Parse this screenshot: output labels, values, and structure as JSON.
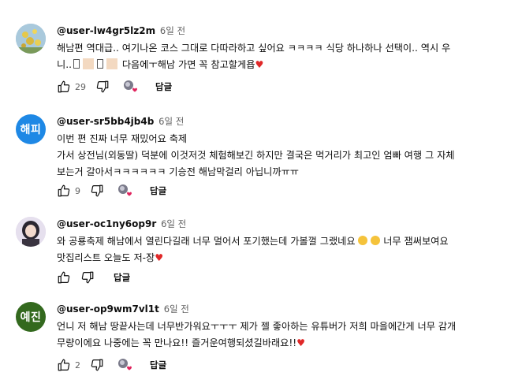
{
  "comments": [
    {
      "author": "@user-lw4gr5lz2m",
      "time": "6일 전",
      "line1": "해남편 역대급.. 여기나온 코스 그대로 다따라하고 싶어요 ㅋㅋㅋㅋ 식당 하나하나 선택이.. 역시 우",
      "line2_a": "니..",
      "line2_b": "다음에ㅜ해남 가면 꼭 참고할게욥",
      "likes": "29",
      "reply": "답글",
      "avatar_color": "#9bbfd6"
    },
    {
      "author": "@user-sr5bb4jb4b",
      "time": "6일 전",
      "lines": [
        "이번 편 진짜 너무 재밌어요 축제",
        "가서 상전님(외동딸) 덕분에 이것저것 체험해보긴 하지만 결국은 먹거리가 최고인 엄빠 여행 그 자체",
        "보는거 갈아서ㅋㅋㅋㅋㅋㅋ 기승전 해남막걸리 아닙니까ㅠㅠ"
      ],
      "likes": "9",
      "reply": "답글",
      "avatar_text": "해피",
      "avatar_color": "#1e88e5"
    },
    {
      "author": "@user-oc1ny6op9r",
      "time": "6일 전",
      "line1_a": "와 공룡축제 해남에서 열린다길래 너무 멀어서 포기했는데 가볼껄 그랬네요",
      "line1_b": "너무 잼써보여요",
      "line2": "맛집리스트 오늘도 저-장",
      "likes": "",
      "reply": "답글",
      "avatar_color": "#d9d0e6"
    },
    {
      "author": "@user-op9wm7vl1t",
      "time": "6일 전",
      "lines": [
        "언니 저 해남 땅끝사는데 너무반가워요ㅜㅜㅜ 제가 젤 좋아하는 유튜버가 저희 마을에간게 너무 감개",
        "무량이에요 나중에는 꼭 만나요!! 즐거운여행되셨길바래요!!"
      ],
      "likes": "2",
      "reply": "답글",
      "avatar_text": "예진",
      "avatar_color": "#33691e"
    }
  ],
  "icons": {
    "like": "thumb-up-icon",
    "dislike": "thumb-down-icon",
    "creator_heart": "creator-heart-icon"
  },
  "heart_color": "#e0245e"
}
